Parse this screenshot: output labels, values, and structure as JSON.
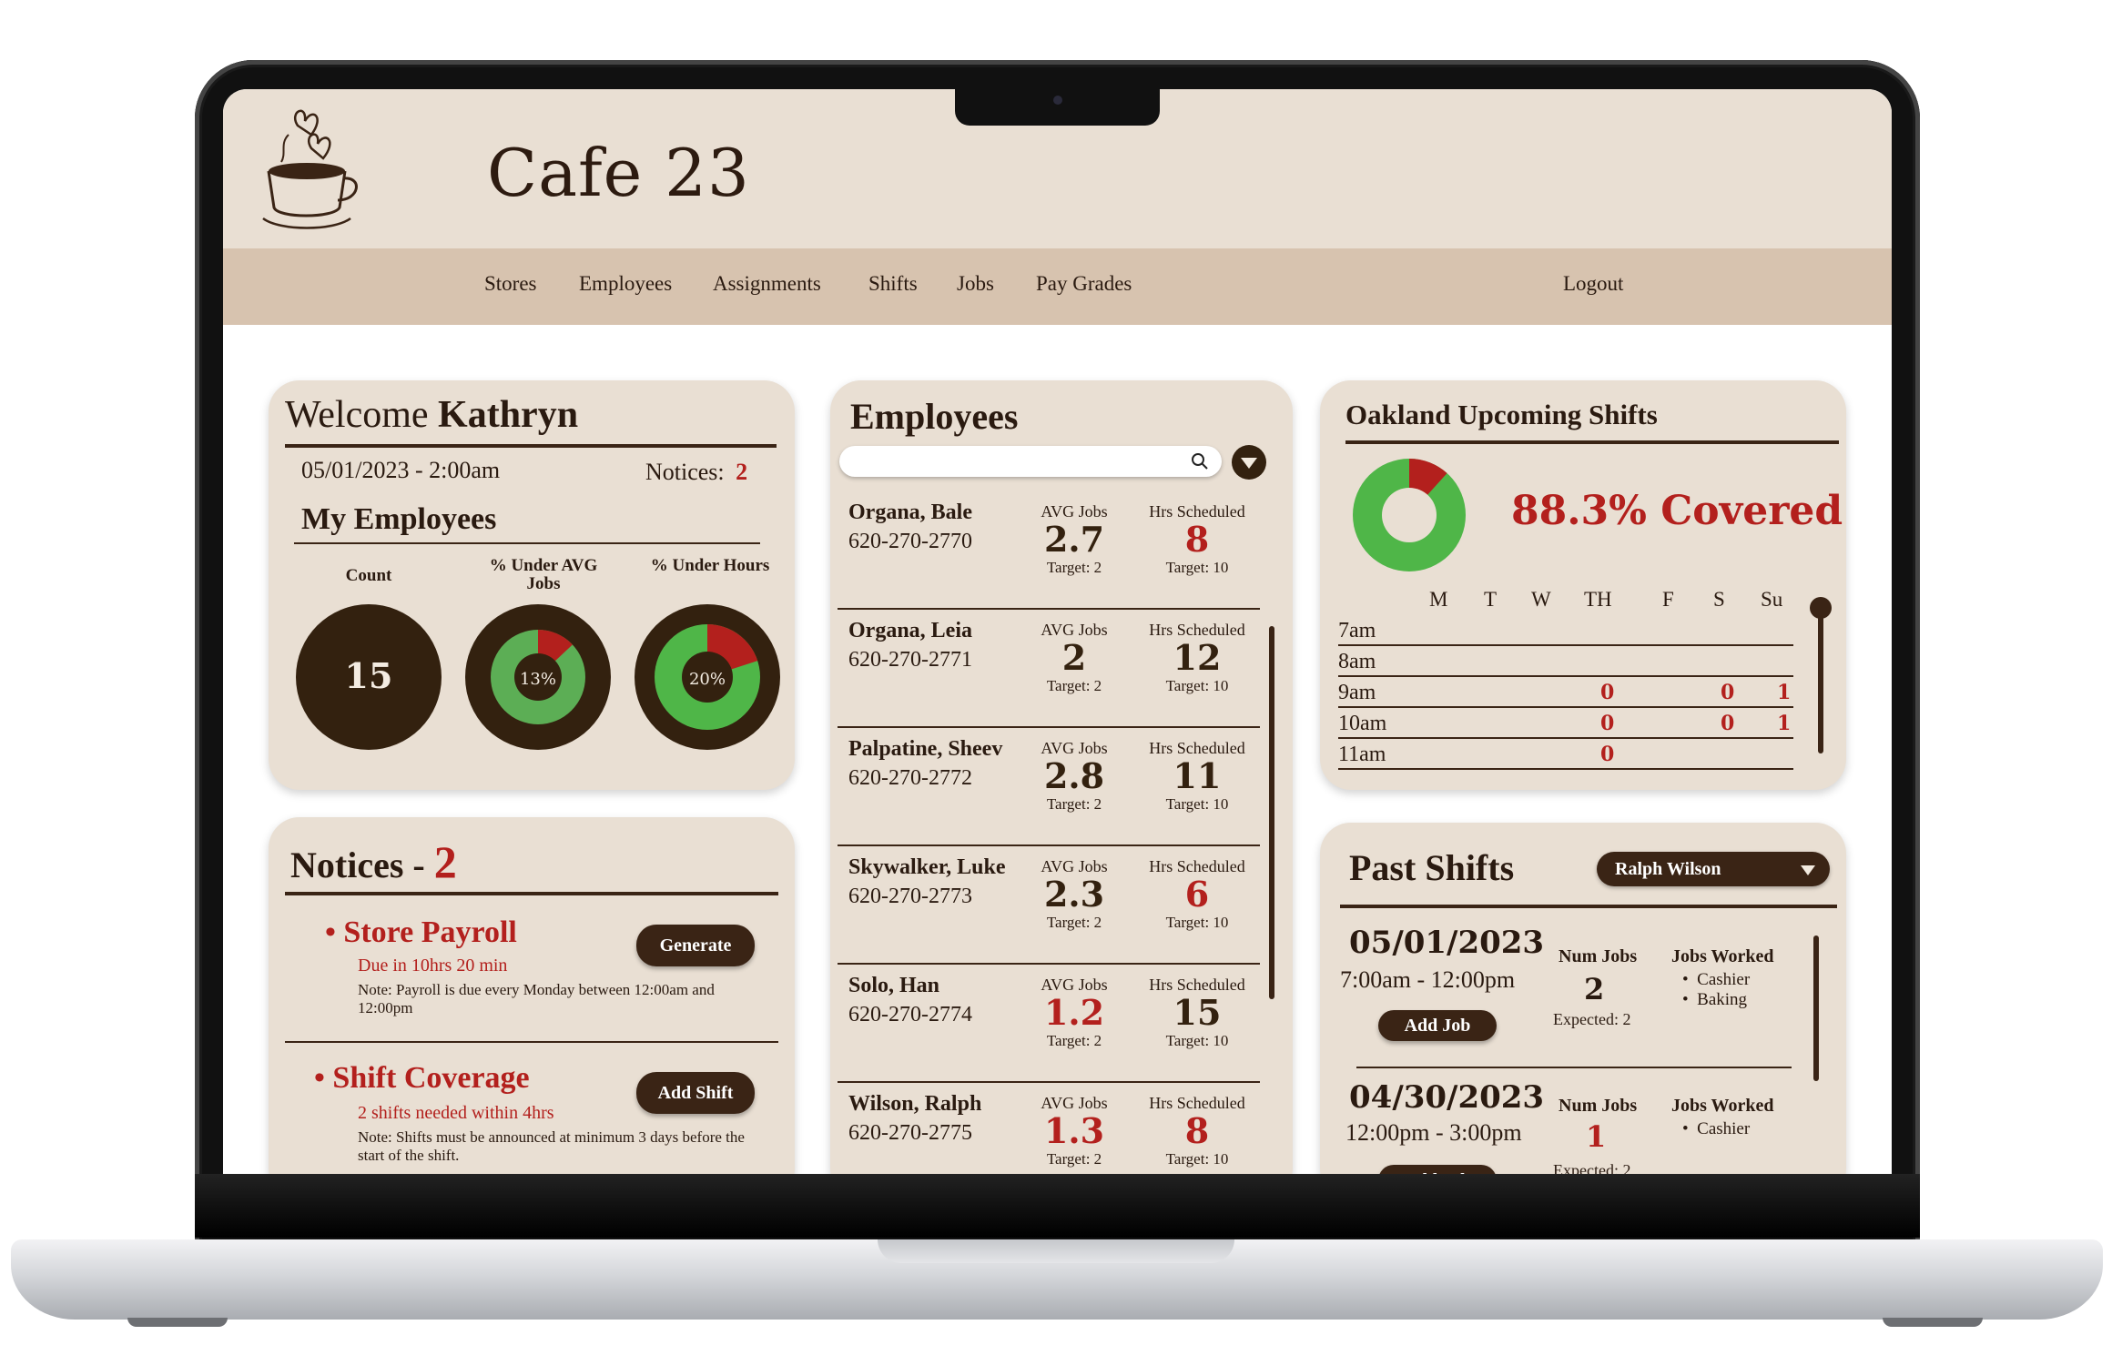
{
  "app": {
    "title": "Cafe 23"
  },
  "nav": {
    "stores": "Stores",
    "employees": "Employees",
    "assignments": "Assignments",
    "shifts": "Shifts",
    "jobs": "Jobs",
    "pay_grades": "Pay Grades",
    "logout": "Logout"
  },
  "welcome": {
    "greeting": "Welcome",
    "name": "Kathryn",
    "datetime": "05/01/2023 - 2:00am",
    "notices_label": "Notices:",
    "notices_count": "2",
    "section_title": "My Employees",
    "stats": [
      {
        "label": "Count",
        "value": "15"
      },
      {
        "label": "% Under AVG Jobs",
        "value": "13%",
        "fraction": 0.13
      },
      {
        "label": "% Under Hours",
        "value": "20%",
        "fraction": 0.2
      }
    ]
  },
  "notices": {
    "title": "Notices -",
    "count": "2",
    "items": [
      {
        "title": "Store Payroll",
        "due": "Due in 10hrs 20 min",
        "note": "Note: Payroll is due every Monday between 12:00am and 12:00pm",
        "button": "Generate"
      },
      {
        "title": "Shift Coverage",
        "due": "2 shifts needed within 4hrs",
        "note": "Note: Shifts must be announced at minimum 3 days before the start of the shift.",
        "button": "Add Shift"
      }
    ]
  },
  "employees": {
    "title": "Employees",
    "search_placeholder": "",
    "avg_label": "AVG Jobs",
    "hrs_label": "Hrs Scheduled",
    "list": [
      {
        "name": "Organa, Bale",
        "phone": "620-270-2770",
        "avg": "2.7",
        "avg_target": "Target: 2",
        "hrs": "8",
        "hrs_target": "Target: 10",
        "avg_red": false,
        "hrs_red": true
      },
      {
        "name": "Organa, Leia",
        "phone": "620-270-2771",
        "avg": "2",
        "avg_target": "Target: 2",
        "hrs": "12",
        "hrs_target": "Target: 10",
        "avg_red": false,
        "hrs_red": false
      },
      {
        "name": "Palpatine, Sheev",
        "phone": "620-270-2772",
        "avg": "2.8",
        "avg_target": "Target: 2",
        "hrs": "11",
        "hrs_target": "Target: 10",
        "avg_red": false,
        "hrs_red": false
      },
      {
        "name": "Skywalker, Luke",
        "phone": "620-270-2773",
        "avg": "2.3",
        "avg_target": "Target: 2",
        "hrs": "6",
        "hrs_target": "Target: 10",
        "avg_red": false,
        "hrs_red": true
      },
      {
        "name": "Solo, Han",
        "phone": "620-270-2774",
        "avg": "1.2",
        "avg_target": "Target: 2",
        "hrs": "15",
        "hrs_target": "Target: 10",
        "avg_red": true,
        "hrs_red": false
      },
      {
        "name": "Wilson, Ralph",
        "phone": "620-270-2775",
        "avg": "1.3",
        "avg_target": "Target: 2",
        "hrs": "8",
        "hrs_target": "Target: 10",
        "avg_red": true,
        "hrs_red": true
      }
    ]
  },
  "upcoming": {
    "title": "Oakland Upcoming Shifts",
    "coverage_text": "88.3% Covered",
    "coverage_fraction": 0.883,
    "days": [
      "M",
      "T",
      "W",
      "TH",
      "F",
      "S",
      "Su"
    ],
    "rows": [
      {
        "time": "7am",
        "values": [
          "",
          "",
          "",
          "",
          "",
          "",
          ""
        ]
      },
      {
        "time": "8am",
        "values": [
          "",
          "",
          "",
          "",
          "",
          "",
          ""
        ]
      },
      {
        "time": "9am",
        "values": [
          "",
          "",
          "",
          "0",
          "",
          "0",
          "1"
        ]
      },
      {
        "time": "10am",
        "values": [
          "",
          "",
          "",
          "0",
          "",
          "0",
          "1"
        ]
      },
      {
        "time": "11am",
        "values": [
          "",
          "",
          "",
          "0",
          "",
          "",
          ""
        ]
      }
    ]
  },
  "past": {
    "title": "Past Shifts",
    "selected_employee": "Ralph Wilson",
    "num_jobs_label": "Num Jobs",
    "jobs_worked_label": "Jobs Worked",
    "add_job": "Add Job",
    "shifts": [
      {
        "date": "05/01/2023",
        "time": "7:00am - 12:00pm",
        "num": "2",
        "expected": "Expected: 2",
        "jobs": [
          "Cashier",
          "Baking"
        ]
      },
      {
        "date": "04/30/2023",
        "time": "12:00pm - 3:00pm",
        "num": "1",
        "expected": "Expected: 2",
        "jobs": [
          "Cashier"
        ]
      }
    ]
  },
  "colors": {
    "card": "#e9dfd3",
    "nav": "#d7c3af",
    "dark": "#3a2415",
    "red": "#b3201d",
    "green": "#53b04a"
  }
}
